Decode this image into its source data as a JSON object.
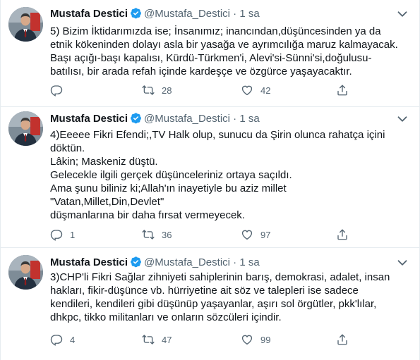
{
  "tweets": [
    {
      "name": "Mustafa Destici",
      "handle": "@Mustafa_Destici",
      "dot": "·",
      "time": "1 sa",
      "lines": [
        "5) Bizim İktidarımızda ise; İnsanımız; inancından,düşüncesinden ya da",
        "etnik kökeninden dolayı asla bir yasağa ve ayrımcılığa maruz kalmayacak.",
        "Başı açığı-başı kapalısı, Kürdü-Türkmen'i, Alevi'si-Sünni'si,doğulusu-",
        "batılısı, bir arada refah içinde kardeşçe ve özgürce yaşayacaktır."
      ],
      "reply_count": "",
      "retweet_count": "28",
      "like_count": "42"
    },
    {
      "name": "Mustafa Destici",
      "handle": "@Mustafa_Destici",
      "dot": "·",
      "time": "1 sa",
      "lines": [
        "4)Eeeee Fikri Efendi;,TV Halk olup, sunucu da Şirin olunca rahatça içini",
        "döktün.",
        "Lâkin; Maskeniz düştü.",
        "Gelecekle ilgili gerçek düşünceleriniz ortaya saçıldı.",
        "Ama şunu biliniz ki;Allah'ın inayetiyle bu aziz millet",
        "\"Vatan,Millet,Din,Devlet\"",
        "düşmanlarına bir daha fırsat vermeyecek."
      ],
      "reply_count": "1",
      "retweet_count": "36",
      "like_count": "97"
    },
    {
      "name": "Mustafa Destici",
      "handle": "@Mustafa_Destici",
      "dot": "·",
      "time": "1 sa",
      "lines": [
        "3)CHP'li Fikri Sağlar zihniyeti sahiplerinin barış, demokrasi, adalet, insan",
        "hakları, fikir-düşünce vb. hürriyetine ait söz ve talepleri ise sadece",
        "kendileri, kendileri gibi düşünüp yaşayanlar, aşırı sol örgütler, pkk'lılar,",
        "dhkpc, tikko militanları ve onların sözcüleri içindir."
      ],
      "reply_count": "4",
      "retweet_count": "47",
      "like_count": "99"
    }
  ],
  "colors": {
    "text": "#0f1419",
    "secondary": "#536471",
    "verified": "#1d9bf0",
    "border": "#e6ecf0"
  },
  "icons": [
    "reply-icon",
    "retweet-icon",
    "like-icon",
    "share-icon",
    "verified-badge-icon",
    "chevron-down-icon"
  ]
}
